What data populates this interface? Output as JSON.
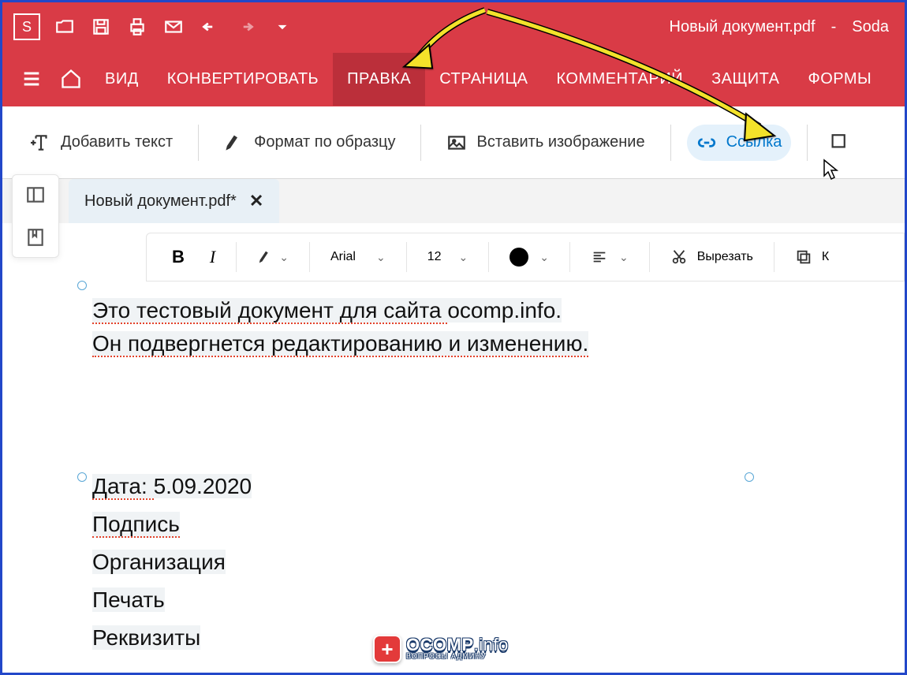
{
  "titlebar": {
    "app_badge": "S",
    "document_title": "Новый документ.pdf",
    "separator": "-",
    "app_name": "Soda"
  },
  "main_tabs": {
    "items": [
      "ВИД",
      "КОНВЕРТИРОВАТЬ",
      "ПРАВКА",
      "СТРАНИЦА",
      "КОММЕНТАРИЙ",
      "ЗАЩИТА",
      "ФОРМЫ"
    ],
    "active_index": 2
  },
  "toolbar": {
    "add_text": "Добавить текст",
    "format_painter": "Формат по образцу",
    "insert_image": "Вставить изображение",
    "link": "Ссылка"
  },
  "doc_tab": {
    "label": "Новый документ.pdf*"
  },
  "format_bar": {
    "font": "Arial",
    "size": "12",
    "cut": "Вырезать",
    "copy_initial": "К"
  },
  "document": {
    "line1_pre": "Это тестовый документ для сайта ",
    "line1_highlight": "ocomp.info",
    "line1_post": ".",
    "line2": "Он подвергнется редактированию и изменению.",
    "date_label": "Дата: ",
    "date_value": "5.09.2020",
    "signature": "Подпись",
    "organization": "Организация",
    "stamp": "Печать",
    "requisites": "Реквизиты"
  },
  "watermark": {
    "main": "OCOMP",
    "suffix": ".info",
    "sub": "ВОПРОСЫ АДМИНУ"
  }
}
